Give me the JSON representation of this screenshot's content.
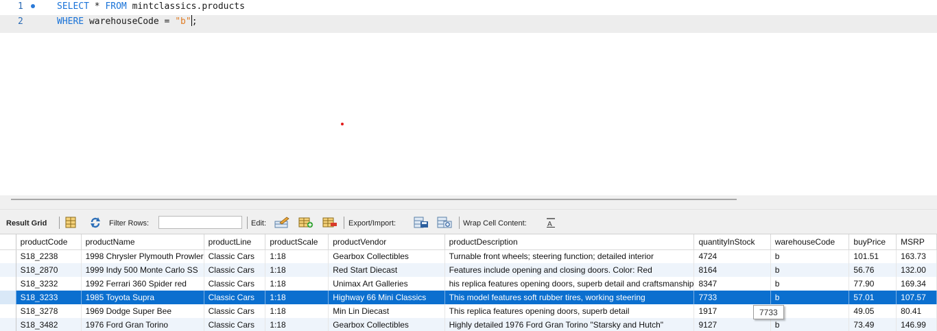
{
  "editor": {
    "lines": [
      {
        "number": "1",
        "kw1": "SELECT",
        "text1": " * ",
        "kw2": "FROM",
        "text2": " mintclassics.products"
      },
      {
        "number": "2",
        "kw1": "WHERE",
        "text1": " warehouseCode = ",
        "str": "\"b\"",
        "text2": ";"
      }
    ]
  },
  "toolbar": {
    "result_grid": "Result Grid",
    "filter_rows": "Filter Rows:",
    "filter_value": "",
    "edit": "Edit:",
    "export_import": "Export/Import:",
    "wrap_cell": "Wrap Cell Content:"
  },
  "grid": {
    "columns": [
      "productCode",
      "productName",
      "productLine",
      "productScale",
      "productVendor",
      "productDescription",
      "quantityInStock",
      "warehouseCode",
      "buyPrice",
      "MSRP"
    ],
    "rows": [
      [
        "S18_2238",
        "1998 Chrysler Plymouth Prowler",
        "Classic Cars",
        "1:18",
        "Gearbox Collectibles",
        "Turnable front wheels; steering function; detailed interior",
        "4724",
        "b",
        "101.51",
        "163.73"
      ],
      [
        "S18_2870",
        "1999 Indy 500 Monte Carlo SS",
        "Classic Cars",
        "1:18",
        "Red Start Diecast",
        "Features include opening and closing doors. Color: Red",
        "8164",
        "b",
        "56.76",
        "132.00"
      ],
      [
        "S18_3232",
        "1992 Ferrari 360 Spider red",
        "Classic Cars",
        "1:18",
        "Unimax Art Galleries",
        "his replica features opening doors, superb detail and craftsmanship",
        "8347",
        "b",
        "77.90",
        "169.34"
      ],
      [
        "S18_3233",
        "1985 Toyota Supra",
        "Classic Cars",
        "1:18",
        "Highway 66 Mini Classics",
        "This model features soft rubber tires, working steering",
        "7733",
        "b",
        "57.01",
        "107.57"
      ],
      [
        "S18_3278",
        "1969 Dodge Super Bee",
        "Classic Cars",
        "1:18",
        "Min Lin Diecast",
        "This replica features opening doors, superb detail",
        "1917",
        "b",
        "49.05",
        "80.41"
      ],
      [
        "S18_3482",
        "1976 Ford Gran Torino",
        "Classic Cars",
        "1:18",
        "Gearbox Collectibles",
        "Highly detailed 1976 Ford Gran Torino \"Starsky and Hutch\"",
        "9127",
        "b",
        "73.49",
        "146.99"
      ]
    ],
    "selected_row": 3,
    "tooltip": "7733"
  },
  "colors": {
    "keyword": "#1872d8",
    "string": "#e07b23",
    "selection": "#0b6fcf",
    "alt_row": "#eef4fb"
  },
  "icons": [
    "grid-view-icon",
    "refresh-icon",
    "edit-row-icon",
    "add-row-icon",
    "delete-row-icon",
    "export-icon",
    "import-icon",
    "wrap-text-icon"
  ]
}
